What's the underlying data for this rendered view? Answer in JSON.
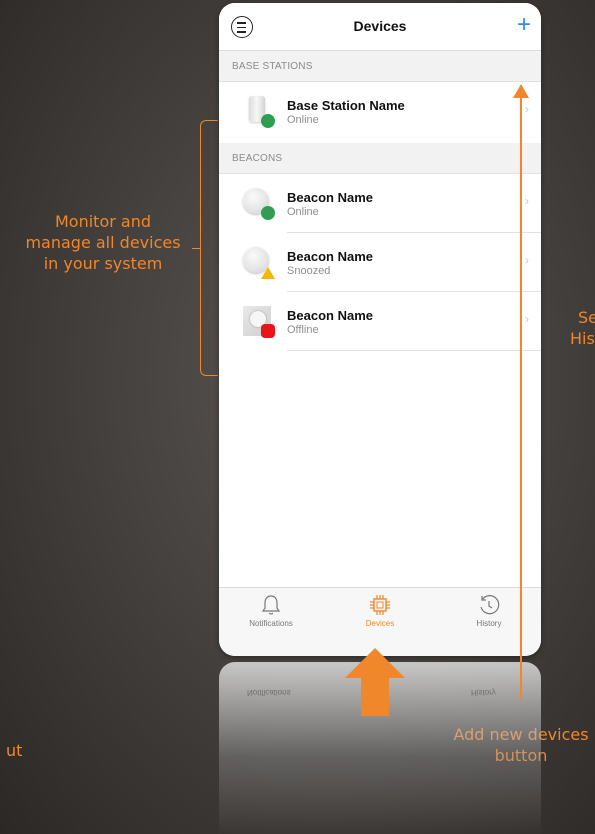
{
  "header": {
    "title": "Devices",
    "add_symbol": "+",
    "menu_icon": "hamburger-circle-icon"
  },
  "sections": [
    {
      "title": "BASE STATIONS",
      "items": [
        {
          "name": "Base Station Name",
          "status": "Online",
          "icon": "base-station-icon",
          "indicator": "green-dot"
        }
      ]
    },
    {
      "title": "BEACONS",
      "items": [
        {
          "name": "Beacon Name",
          "status": "Online",
          "icon": "beacon-icon",
          "indicator": "green-dot"
        },
        {
          "name": "Beacon Name",
          "status": "Snoozed",
          "icon": "beacon-icon",
          "indicator": "yellow-triangle"
        },
        {
          "name": "Beacon Name",
          "status": "Offline",
          "icon": "beacon-photo-icon",
          "indicator": "red-octagon"
        }
      ]
    }
  ],
  "tabbar": {
    "tabs": [
      {
        "label": "Notifications",
        "icon": "bell-icon",
        "active": false
      },
      {
        "label": "Devices",
        "icon": "chip-icon",
        "active": true
      },
      {
        "label": "History",
        "icon": "history-clock-icon",
        "active": false
      }
    ]
  },
  "reflection": {
    "left_text": "Notifications",
    "right_text": "History"
  },
  "annotations": {
    "monitor": [
      "Monitor and",
      "manage all devices",
      "in your system"
    ],
    "history_cut": [
      "Se",
      "His"
    ],
    "add_button": [
      "Add new devices",
      "button"
    ],
    "left_cut": "ut"
  },
  "colors": {
    "accent": "#f0872a",
    "add_blue": "#2f8ae5",
    "online": "#2f9e52",
    "snoozed": "#f5b800",
    "offline": "#e8161b"
  }
}
